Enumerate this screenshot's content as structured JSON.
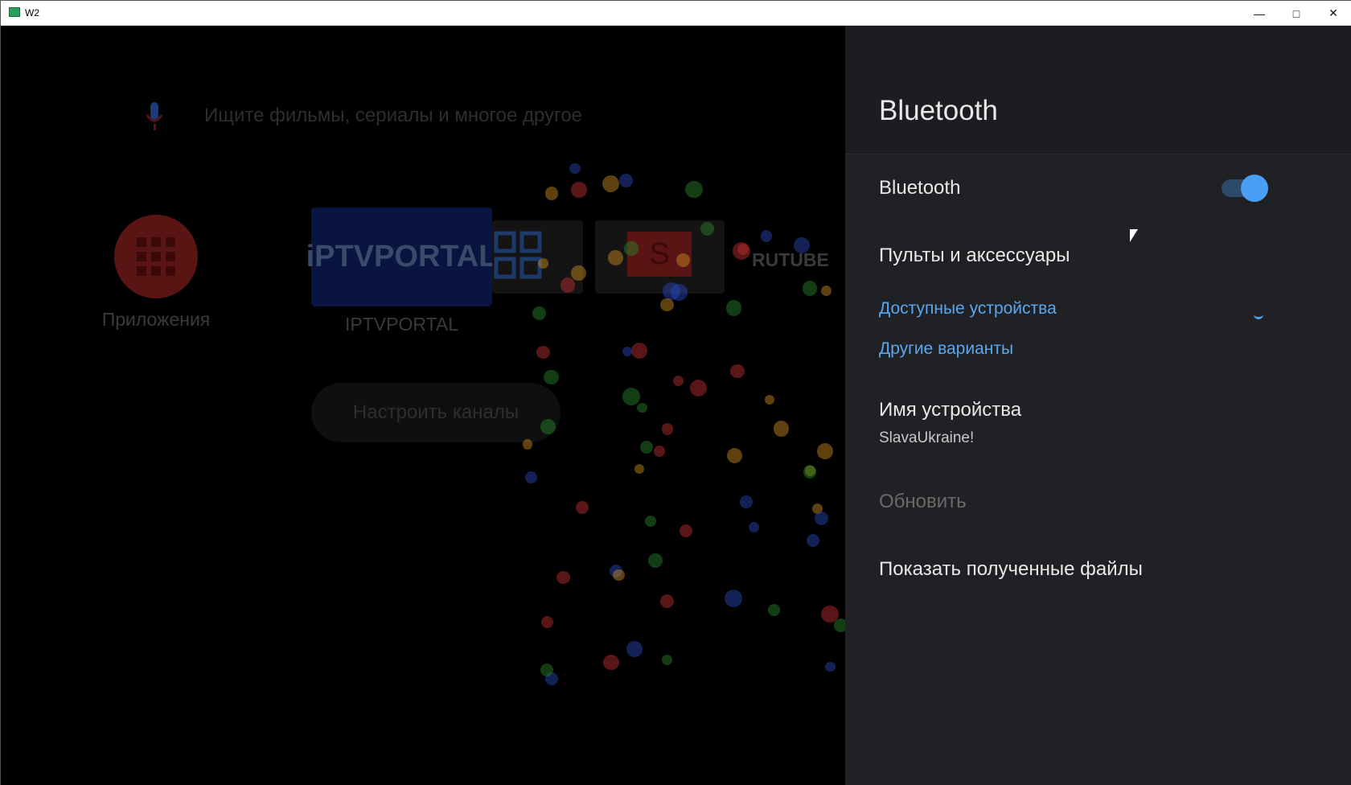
{
  "window": {
    "title": "W2",
    "minimize_icon": "minimize-icon",
    "maximize_icon": "maximize-icon",
    "close_icon": "close-icon"
  },
  "home": {
    "search_placeholder": "Ищите фильмы, сериалы и многое другое",
    "apps_label": "Приложения",
    "tiles": [
      {
        "label": "IPTVPORTAL",
        "logo": "iPTVPORTAL"
      },
      {
        "logo": "S"
      },
      {
        "logo": "RUTUBE"
      }
    ],
    "setup_channels": "Настроить каналы"
  },
  "panel": {
    "title": "Bluetooth",
    "bluetooth_label": "Bluetooth",
    "bluetooth_on": true,
    "accent": "#4a9ff5",
    "remotes": "Пульты и аксессуары",
    "available": "Доступные устройства",
    "other": "Другие варианты",
    "device_name_label": "Имя устройства",
    "device_name": "SlavaUkraine!",
    "refresh": "Обновить",
    "show_files": "Показать полученные файлы"
  }
}
